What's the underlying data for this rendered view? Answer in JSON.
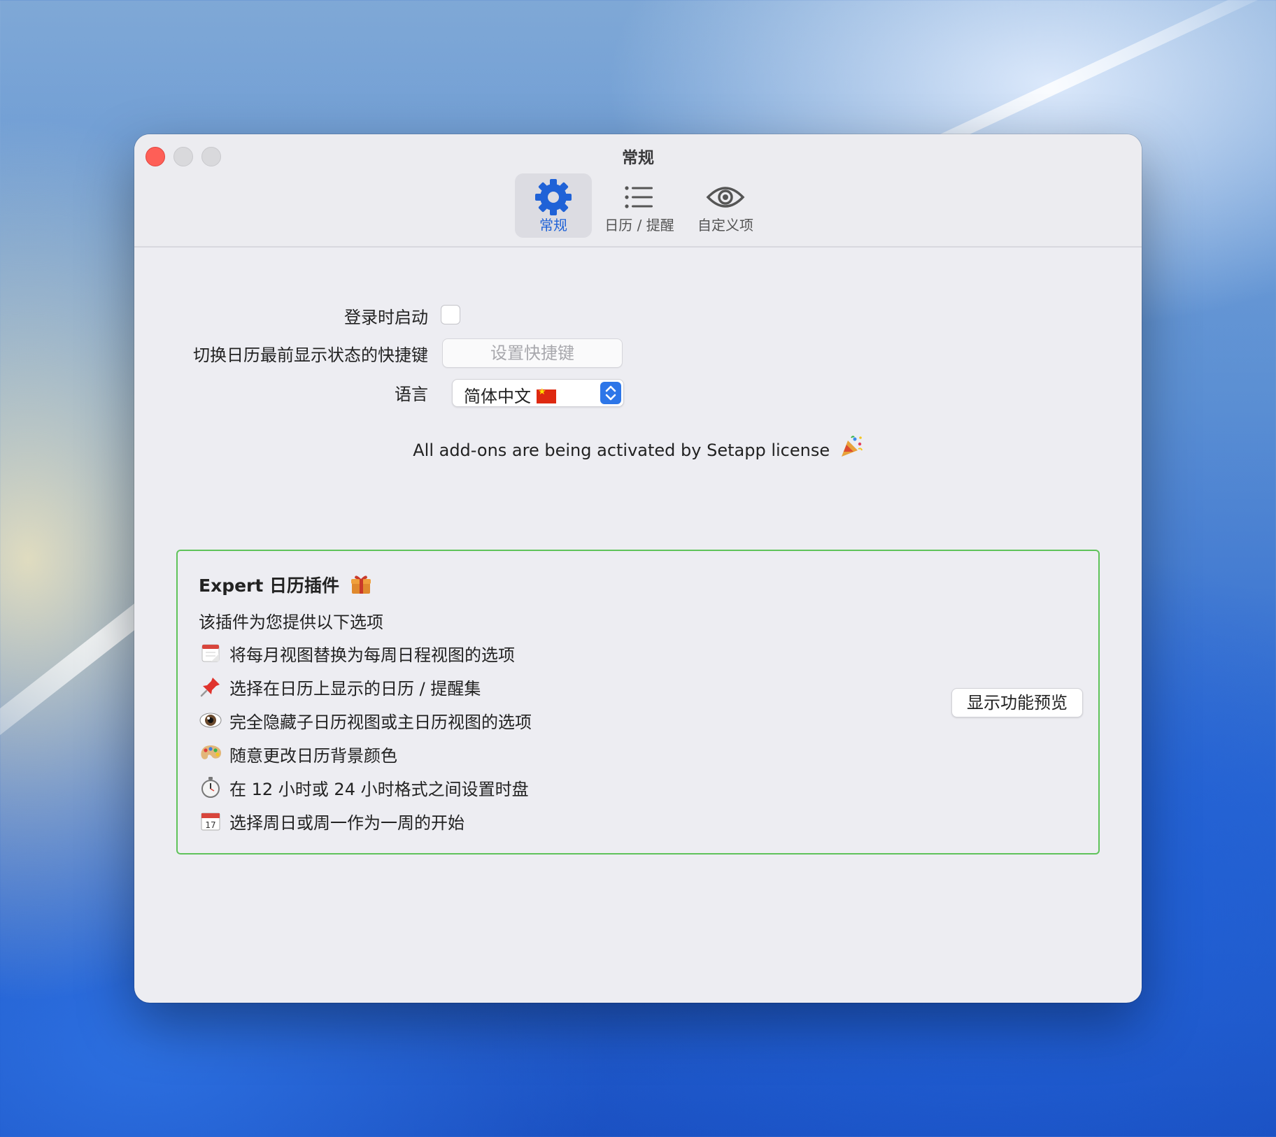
{
  "window": {
    "title": "常规"
  },
  "toolbar": {
    "tabs": [
      {
        "label": "常规",
        "icon": "gear-icon",
        "active": true
      },
      {
        "label": "日历 / 提醒",
        "icon": "list-icon",
        "active": false
      },
      {
        "label": "自定义项",
        "icon": "eye-icon",
        "active": false
      }
    ]
  },
  "settings": {
    "launch_at_login_label": "登录时启动",
    "launch_at_login_checked": false,
    "shortcut_label": "切换日历最前显示状态的快捷键",
    "shortcut_button": "设置快捷键",
    "language_label": "语言",
    "language_value": "简体中文"
  },
  "activation_message": "All add-ons are being activated by Setapp license",
  "expert": {
    "title": "Expert 日历插件",
    "subtitle": "该插件为您提供以下选项",
    "features": [
      {
        "icon": "calendar-tearoff-icon",
        "text": "将每月视图替换为每周日程视图的选项"
      },
      {
        "icon": "pushpin-icon",
        "text": "选择在日历上显示的日历 / 提醒集"
      },
      {
        "icon": "eye-emoji-icon",
        "text": "完全隐藏子日历视图或主日历视图的选项"
      },
      {
        "icon": "palette-icon",
        "text": "随意更改日历背景颜色"
      },
      {
        "icon": "stopwatch-icon",
        "text": "在 12 小时或 24 小时格式之间设置时盘"
      },
      {
        "icon": "calendar-17-icon",
        "text": "选择周日或周一作为一周的开始"
      }
    ],
    "preview_button": "显示功能预览"
  },
  "colors": {
    "accent": "#1f62d7",
    "close": "#fe5f57",
    "border_green": "#5fc35a"
  }
}
